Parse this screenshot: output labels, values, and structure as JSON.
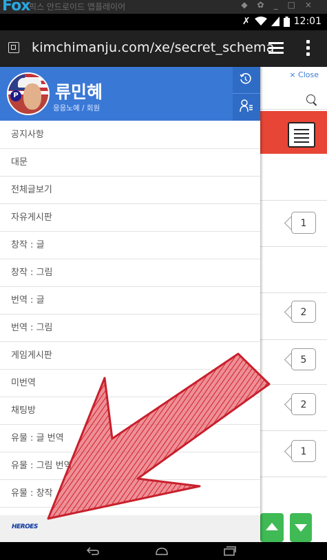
{
  "emulator_title": "픽스 안드로이드 앱플레이어",
  "status": {
    "time": "12:01"
  },
  "browser": {
    "url": "kimchimanju.com/xe/secret_schema"
  },
  "page": {
    "close_label": "× Close",
    "comment_counts": [
      "1",
      "2",
      "5",
      "2",
      "1"
    ]
  },
  "drawer": {
    "user_name": "류민혜",
    "user_role": "응응노예 / 회원",
    "menu_items": [
      "공지사항",
      "대문",
      "전체글보기",
      "자유게시판",
      "창작 : 글",
      "창작 : 그림",
      "번역 : 글",
      "번역 : 그림",
      "게임게시판",
      "미번역",
      "채팅방",
      "유물 : 글 번역",
      "유물 : 그림 번역",
      "유물 : 창작"
    ],
    "footer_logo_text": "HEROES"
  },
  "colors": {
    "header_blue": "#3a78d6",
    "red_bar": "#e74535",
    "scroll_green": "#3fba55",
    "arrow_red": "#e0333f"
  },
  "icons": [
    "history-icon",
    "user-list-icon",
    "search-icon",
    "tabs-icon",
    "overflow-menu-icon",
    "back-icon",
    "home-icon",
    "recent-apps-icon"
  ]
}
